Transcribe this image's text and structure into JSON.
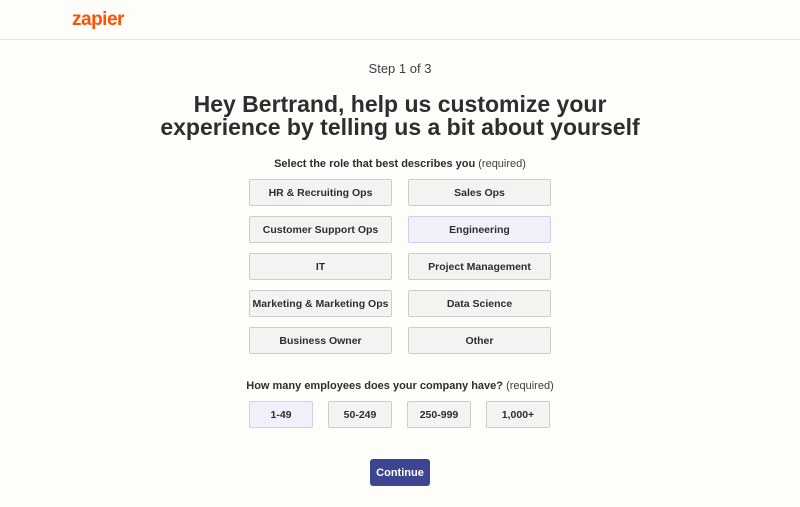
{
  "header": {
    "logo_text": "zapier",
    "brand_color": "#ff4f00"
  },
  "step_indicator": "Step 1 of 3",
  "headline": {
    "line1": "Hey Bertrand, help us customize your",
    "line2": "experience by telling us a bit about yourself"
  },
  "role_section": {
    "label": "Select the role that best describes you",
    "required": "(required)",
    "selected": "Engineering",
    "options": [
      "HR & Recruiting Ops",
      "Sales Ops",
      "Customer Support Ops",
      "Engineering",
      "IT",
      "Project Management",
      "Marketing & Marketing Ops",
      "Data Science",
      "Business Owner",
      "Other"
    ]
  },
  "size_section": {
    "label": "How many employees does your company have?",
    "required": "(required)",
    "selected": "1-49",
    "options": [
      "1-49",
      "50-249",
      "250-999",
      "1,000+"
    ]
  },
  "continue_label": "Continue",
  "colors": {
    "accent": "#3d4592",
    "selected_bg": "#f0f0fb",
    "page_bg": "#fffdf9"
  }
}
